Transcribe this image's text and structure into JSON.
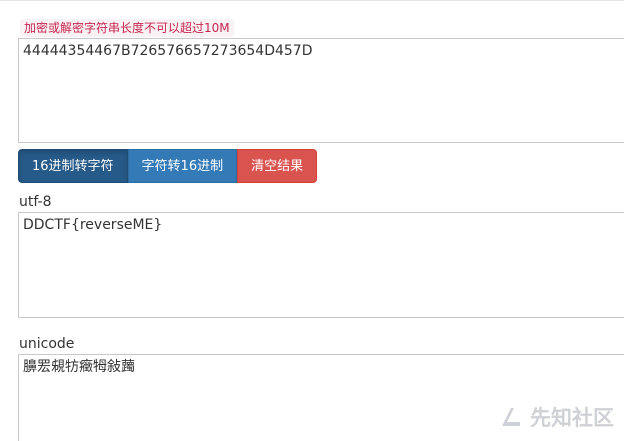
{
  "hint": {
    "text": "加密或解密字符串长度不可以超过10M"
  },
  "input": {
    "value": "44444354467B726576657273654D457D"
  },
  "buttons": {
    "hex_to_text": "16进制转字符",
    "text_to_hex": "字符转16进制",
    "clear": "清空结果"
  },
  "utf8": {
    "label": "utf-8",
    "value": "DDCTF{reverseME}"
  },
  "unicode": {
    "label": "unicode",
    "value": "䑄䍔䙻牥癥牳敍䕽"
  },
  "watermark": {
    "text": "先知社区",
    "icon": "xianzhi-logo-icon"
  },
  "colors": {
    "hint_text": "#c7254e",
    "hint_bg": "#f9f2f4",
    "btn_active": "#265a88",
    "btn_primary": "#337ab7",
    "btn_danger": "#d9534f"
  }
}
